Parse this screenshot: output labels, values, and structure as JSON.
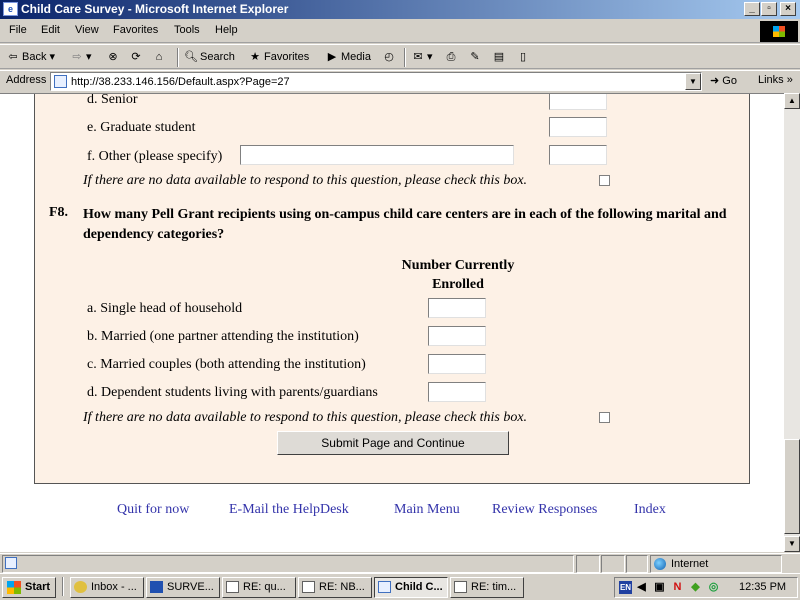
{
  "window": {
    "title": "Child Care Survey - Microsoft Internet Explorer"
  },
  "menu": [
    "File",
    "Edit",
    "View",
    "Favorites",
    "Tools",
    "Help"
  ],
  "toolbar": {
    "back": "Back",
    "search": "Search",
    "favorites": "Favorites",
    "media": "Media"
  },
  "address": {
    "label": "Address",
    "url": "http://38.233.146.156/Default.aspx?Page=27",
    "go": "Go",
    "links": "Links"
  },
  "form": {
    "prev_rows": [
      {
        "label": "d.  Senior"
      },
      {
        "label": "e.  Graduate student"
      },
      {
        "label": "f.  Other (please specify)"
      }
    ],
    "no_data_note": "If there are no data available to respond to this question, please check this box.",
    "question": {
      "number": "F8.",
      "text": "How many Pell Grant recipients using on-campus child care centers are in each of the following marital and dependency categories?",
      "column_header_1": "Number Currently",
      "column_header_2": "Enrolled",
      "rows": [
        {
          "label": "a.  Single head of household"
        },
        {
          "label": "b.  Married (one partner attending the institution)"
        },
        {
          "label": "c.  Married couples (both attending the institution)"
        },
        {
          "label": "d.  Dependent students living with parents/guardians"
        }
      ]
    },
    "submit_label": "Submit Page and Continue"
  },
  "nav_links": [
    "Quit for now",
    "E-Mail the HelpDesk",
    "Main Menu",
    "Review Responses",
    "Index"
  ],
  "status": {
    "zone": "Internet"
  },
  "taskbar": {
    "start": "Start",
    "tasks": [
      "Inbox - ...",
      "SURVE...",
      "RE: qu...",
      "RE: NB...",
      "Child C...",
      "RE: tim..."
    ],
    "clock": "12:35 PM"
  }
}
